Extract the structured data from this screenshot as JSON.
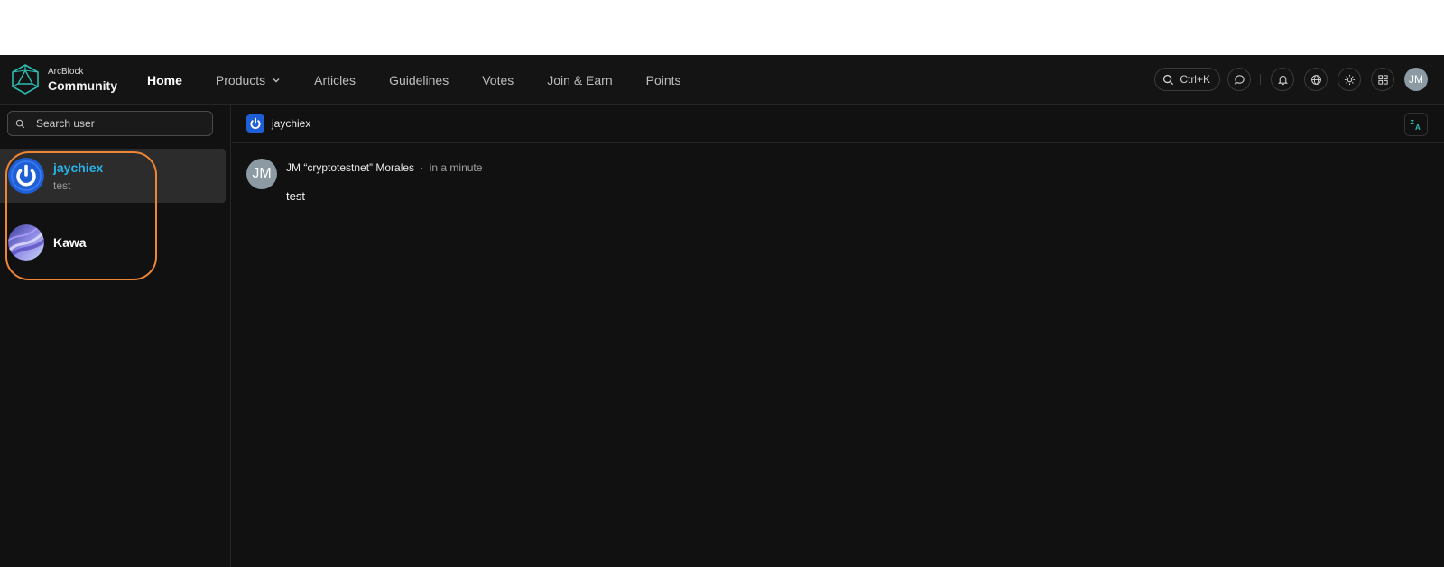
{
  "brand": {
    "small": "ArcBlock",
    "big": "Community"
  },
  "nav": {
    "items": [
      {
        "label": "Home",
        "active": true
      },
      {
        "label": "Products",
        "has_dropdown": true
      },
      {
        "label": "Articles"
      },
      {
        "label": "Guidelines"
      },
      {
        "label": "Votes"
      },
      {
        "label": "Join & Earn"
      },
      {
        "label": "Points"
      }
    ]
  },
  "toolbar": {
    "search_shortcut": "Ctrl+K",
    "icons": [
      "search-icon",
      "chat-icon",
      "bell-icon",
      "globe-icon",
      "sun-icon",
      "grid-icon"
    ],
    "user_initials": "JM"
  },
  "sidebar": {
    "search_placeholder": "Search user",
    "conversations": [
      {
        "name": "jaychiex",
        "preview": "test",
        "selected": true
      },
      {
        "name": "Kawa",
        "preview": ""
      }
    ]
  },
  "chat": {
    "title": "jaychiex",
    "messages": [
      {
        "avatar_initials": "JM",
        "author": "JM “cryptotestnet” Morales",
        "separator": "·",
        "time": "in a minute",
        "text": "test"
      }
    ]
  },
  "colors": {
    "background": "#111111",
    "accent_active_name": "#27b3e8",
    "highlight_ring": "#ef8636",
    "logo": "#2dbcb0",
    "avatar_gray": "#8b9aa3",
    "power_avatar_blue": "#1f5fd6"
  }
}
